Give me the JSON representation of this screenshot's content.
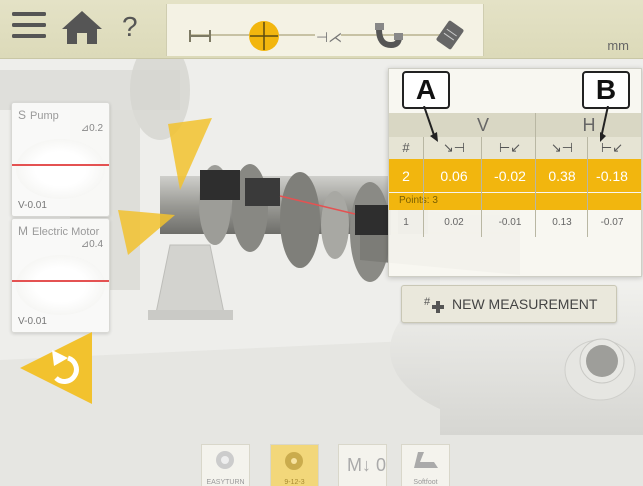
{
  "header": {
    "steps": [
      {
        "icon": "dimensions-icon",
        "active": false
      },
      {
        "icon": "measure-target-icon",
        "active": true
      },
      {
        "icon": "results-icon",
        "active": false
      },
      {
        "icon": "correction-magnet-icon",
        "active": false
      },
      {
        "icon": "report-icon",
        "active": false
      }
    ],
    "units": "mm"
  },
  "sensors": [
    {
      "letter": "S",
      "name": "Pump",
      "angle": "⊿0.2",
      "value": "V-0.01"
    },
    {
      "letter": "M",
      "name": "Electric Motor",
      "angle": "⊿0.4",
      "value": "V-0.01"
    }
  ],
  "table": {
    "groups": {
      "v": "V",
      "h": "H"
    },
    "hash_header": "#",
    "rows": [
      {
        "n": "2",
        "v1": "0.06",
        "v2": "-0.02",
        "h1": "0.38",
        "h2": "-0.18",
        "points": "Points: 3"
      },
      {
        "n": "1",
        "v1": "0.02",
        "v2": "-0.01",
        "h1": "0.13",
        "h2": "-0.07"
      }
    ]
  },
  "callouts": {
    "a": "A",
    "b": "B"
  },
  "actions": {
    "new_measurement": "NEW MEASUREMENT"
  },
  "tools": {
    "easyturn": "EASYTURN",
    "pattern": "9-12-3",
    "multipoint": "M↓ 0",
    "softfoot": "Softfoot"
  },
  "colors": {
    "accent": "#f2b60e",
    "laser": "#e45252",
    "header": "#dedcbc"
  }
}
